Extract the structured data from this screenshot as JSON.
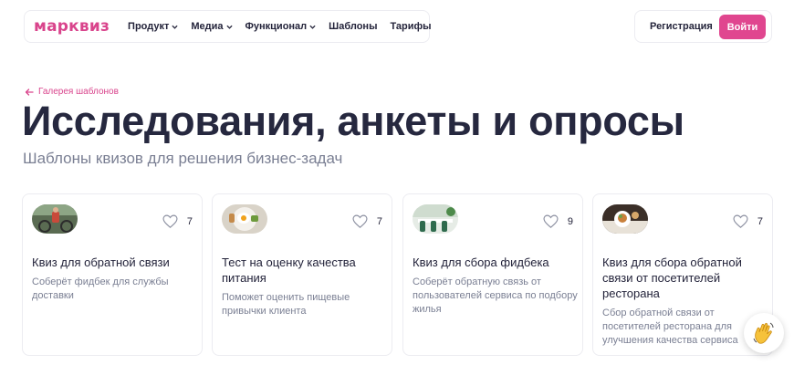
{
  "header": {
    "logo": "марквиз",
    "menu": [
      {
        "label": "Продукт",
        "dropdown": true
      },
      {
        "label": "Медиа",
        "dropdown": true
      },
      {
        "label": "Функционал",
        "dropdown": true
      },
      {
        "label": "Шаблоны",
        "dropdown": false
      },
      {
        "label": "Тарифы",
        "dropdown": false
      }
    ],
    "register_label": "Регистрация",
    "login_label": "Войти"
  },
  "breadcrumb": {
    "label": "Галерея шаблонов",
    "icon": "arrow-left-icon"
  },
  "page": {
    "title": "Исследования, анкеты и опросы",
    "subtitle": "Шаблоны квизов для решения бизнес-задач"
  },
  "cards": [
    {
      "title": "Квиз для обратной связи",
      "description": "Соберёт фидбек для службы доставки",
      "likes": "7",
      "thumb": "courier-photo"
    },
    {
      "title": "Тест на оценку качества питания",
      "description": "Поможет оценить пищевые привычки клиента",
      "likes": "7",
      "thumb": "breakfast-photo"
    },
    {
      "title": "Квиз для сбора фидбека",
      "description": "Соберёт обратную связь от пользователей сервиса по подбору жилья",
      "likes": "9",
      "thumb": "interior-photo"
    },
    {
      "title": "Квиз для сбора обратной связи от посетителей ресторана",
      "description": "Сбор обратной связи от посетителей ресторана для улучшения качества сервиса",
      "likes": "7",
      "thumb": "restaurant-photo"
    }
  ],
  "colors": {
    "accent": "#e0468f",
    "text": "#23233a",
    "muted": "#7a7f93"
  },
  "chat_widget": {
    "icon": "waving-hand-icon"
  }
}
